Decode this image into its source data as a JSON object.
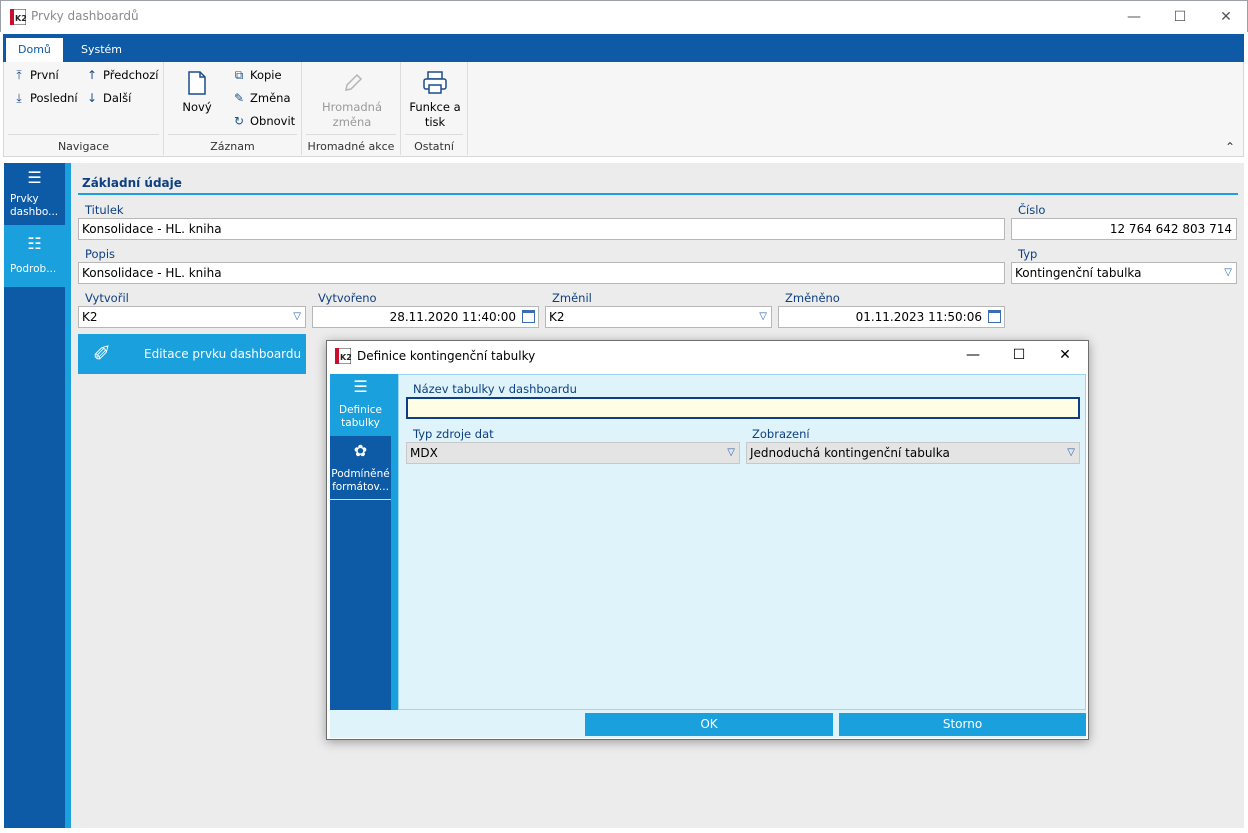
{
  "window": {
    "title": "Prvky dashboardů",
    "minimize": "—",
    "maximize": "☐",
    "close": "✕"
  },
  "ribbon": {
    "tabs": [
      "Domů",
      "Systém"
    ],
    "groups": {
      "navigace": {
        "label": "Navigace",
        "items": [
          "První",
          "Poslední",
          "Předchozí",
          "Další"
        ]
      },
      "zaznam": {
        "label": "Záznam",
        "new": "Nový",
        "items": [
          "Kopie",
          "Změna",
          "Obnovit"
        ]
      },
      "hromadne": {
        "label": "Hromadné akce",
        "btn1": "Hromadná",
        "btn2": "změna"
      },
      "ostatni": {
        "label": "Ostatní",
        "btn1": "Funkce a",
        "btn2": "tisk"
      }
    }
  },
  "leftnav": [
    {
      "label1": "Prvky",
      "label2": "dashbo..."
    },
    {
      "label1": "Podrob...",
      "label2": ""
    }
  ],
  "section": {
    "title": "Základní údaje"
  },
  "fields": {
    "titulek": {
      "label": "Titulek",
      "value": "Konsolidace - HL. kniha"
    },
    "cislo": {
      "label": "Číslo",
      "value": "12 764 642 803 714"
    },
    "popis": {
      "label": "Popis",
      "value": "Konsolidace - HL. kniha"
    },
    "typ": {
      "label": "Typ",
      "value": "Kontingenční tabulka"
    },
    "vytvoril": {
      "label": "Vytvořil",
      "value": "K2"
    },
    "vytvoreno": {
      "label": "Vytvořeno",
      "value": "28.11.2020 11:40:00"
    },
    "zmenil": {
      "label": "Změnil",
      "value": "K2"
    },
    "zmeneno": {
      "label": "Změněno",
      "value": "01.11.2023 11:50:06"
    }
  },
  "editbtn": {
    "label": "Editace prvku dashboardu"
  },
  "dialog": {
    "title": "Definice kontingenční tabulky",
    "nav": [
      {
        "label1": "Definice",
        "label2": "tabulky"
      },
      {
        "label1": "Podmíněné",
        "label2": "formátov..."
      }
    ],
    "nazev": {
      "label": "Název tabulky v dashboardu",
      "value": ""
    },
    "typ_zdroje": {
      "label": "Typ zdroje dat",
      "value": "MDX"
    },
    "zobrazeni": {
      "label": "Zobrazení",
      "value": "Jednoduchá kontingenční tabulka"
    },
    "ok": "OK",
    "storno": "Storno"
  }
}
